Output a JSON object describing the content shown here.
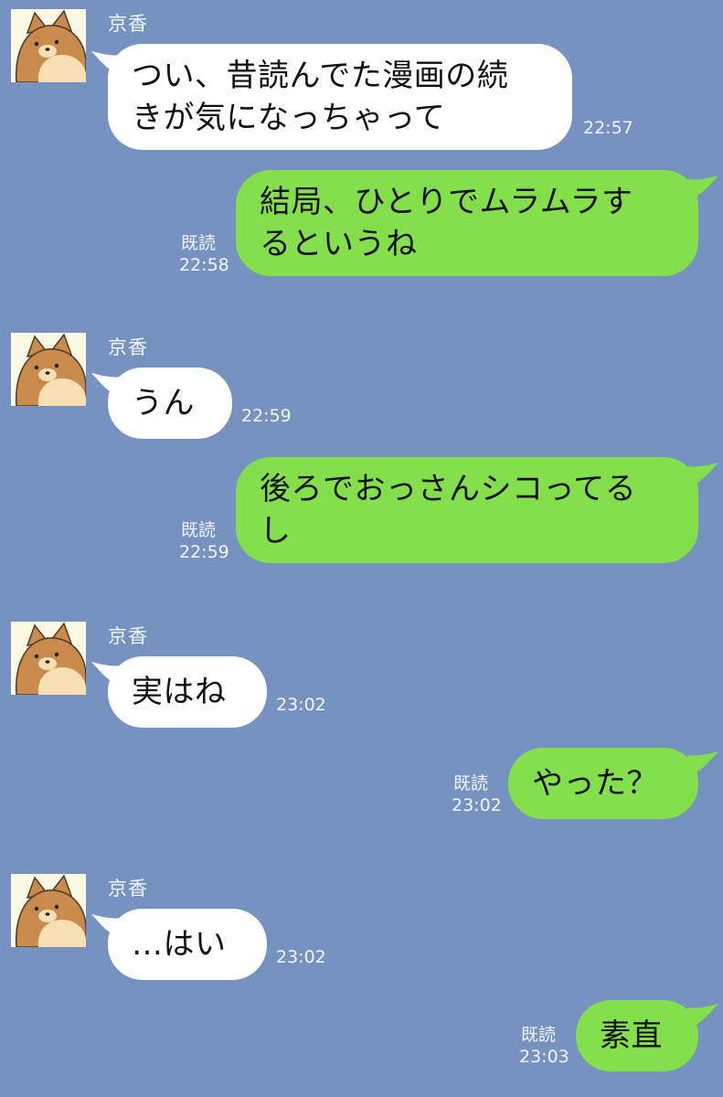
{
  "colors": {
    "background": "#7592c0",
    "received_bubble": "#ffffff",
    "sent_bubble": "#84e04a",
    "meta_text": "#f4f6fb"
  },
  "avatar_icon": "shiba-dog-face-icon",
  "messages": [
    {
      "direction": "received",
      "sender": "京香",
      "text": "つい、昔読んでた漫画の続\nきが気になっちゃって",
      "time": "22:57"
    },
    {
      "direction": "sent",
      "read": "既読",
      "text": "結局、ひとりでムラムラす\nるというね",
      "time": "22:58"
    },
    {
      "direction": "received",
      "sender": "京香",
      "text": "うん",
      "time": "22:59"
    },
    {
      "direction": "sent",
      "read": "既読",
      "text": "後ろでおっさんシコってる\nし",
      "time": "22:59"
    },
    {
      "direction": "received",
      "sender": "京香",
      "text": "実はね",
      "time": "23:02"
    },
    {
      "direction": "sent",
      "read": "既読",
      "text": "やった？",
      "time": "23:02"
    },
    {
      "direction": "received",
      "sender": "京香",
      "text": "…はい",
      "time": "23:02"
    },
    {
      "direction": "sent",
      "read": "既読",
      "text": "素直",
      "time": "23:03"
    }
  ]
}
